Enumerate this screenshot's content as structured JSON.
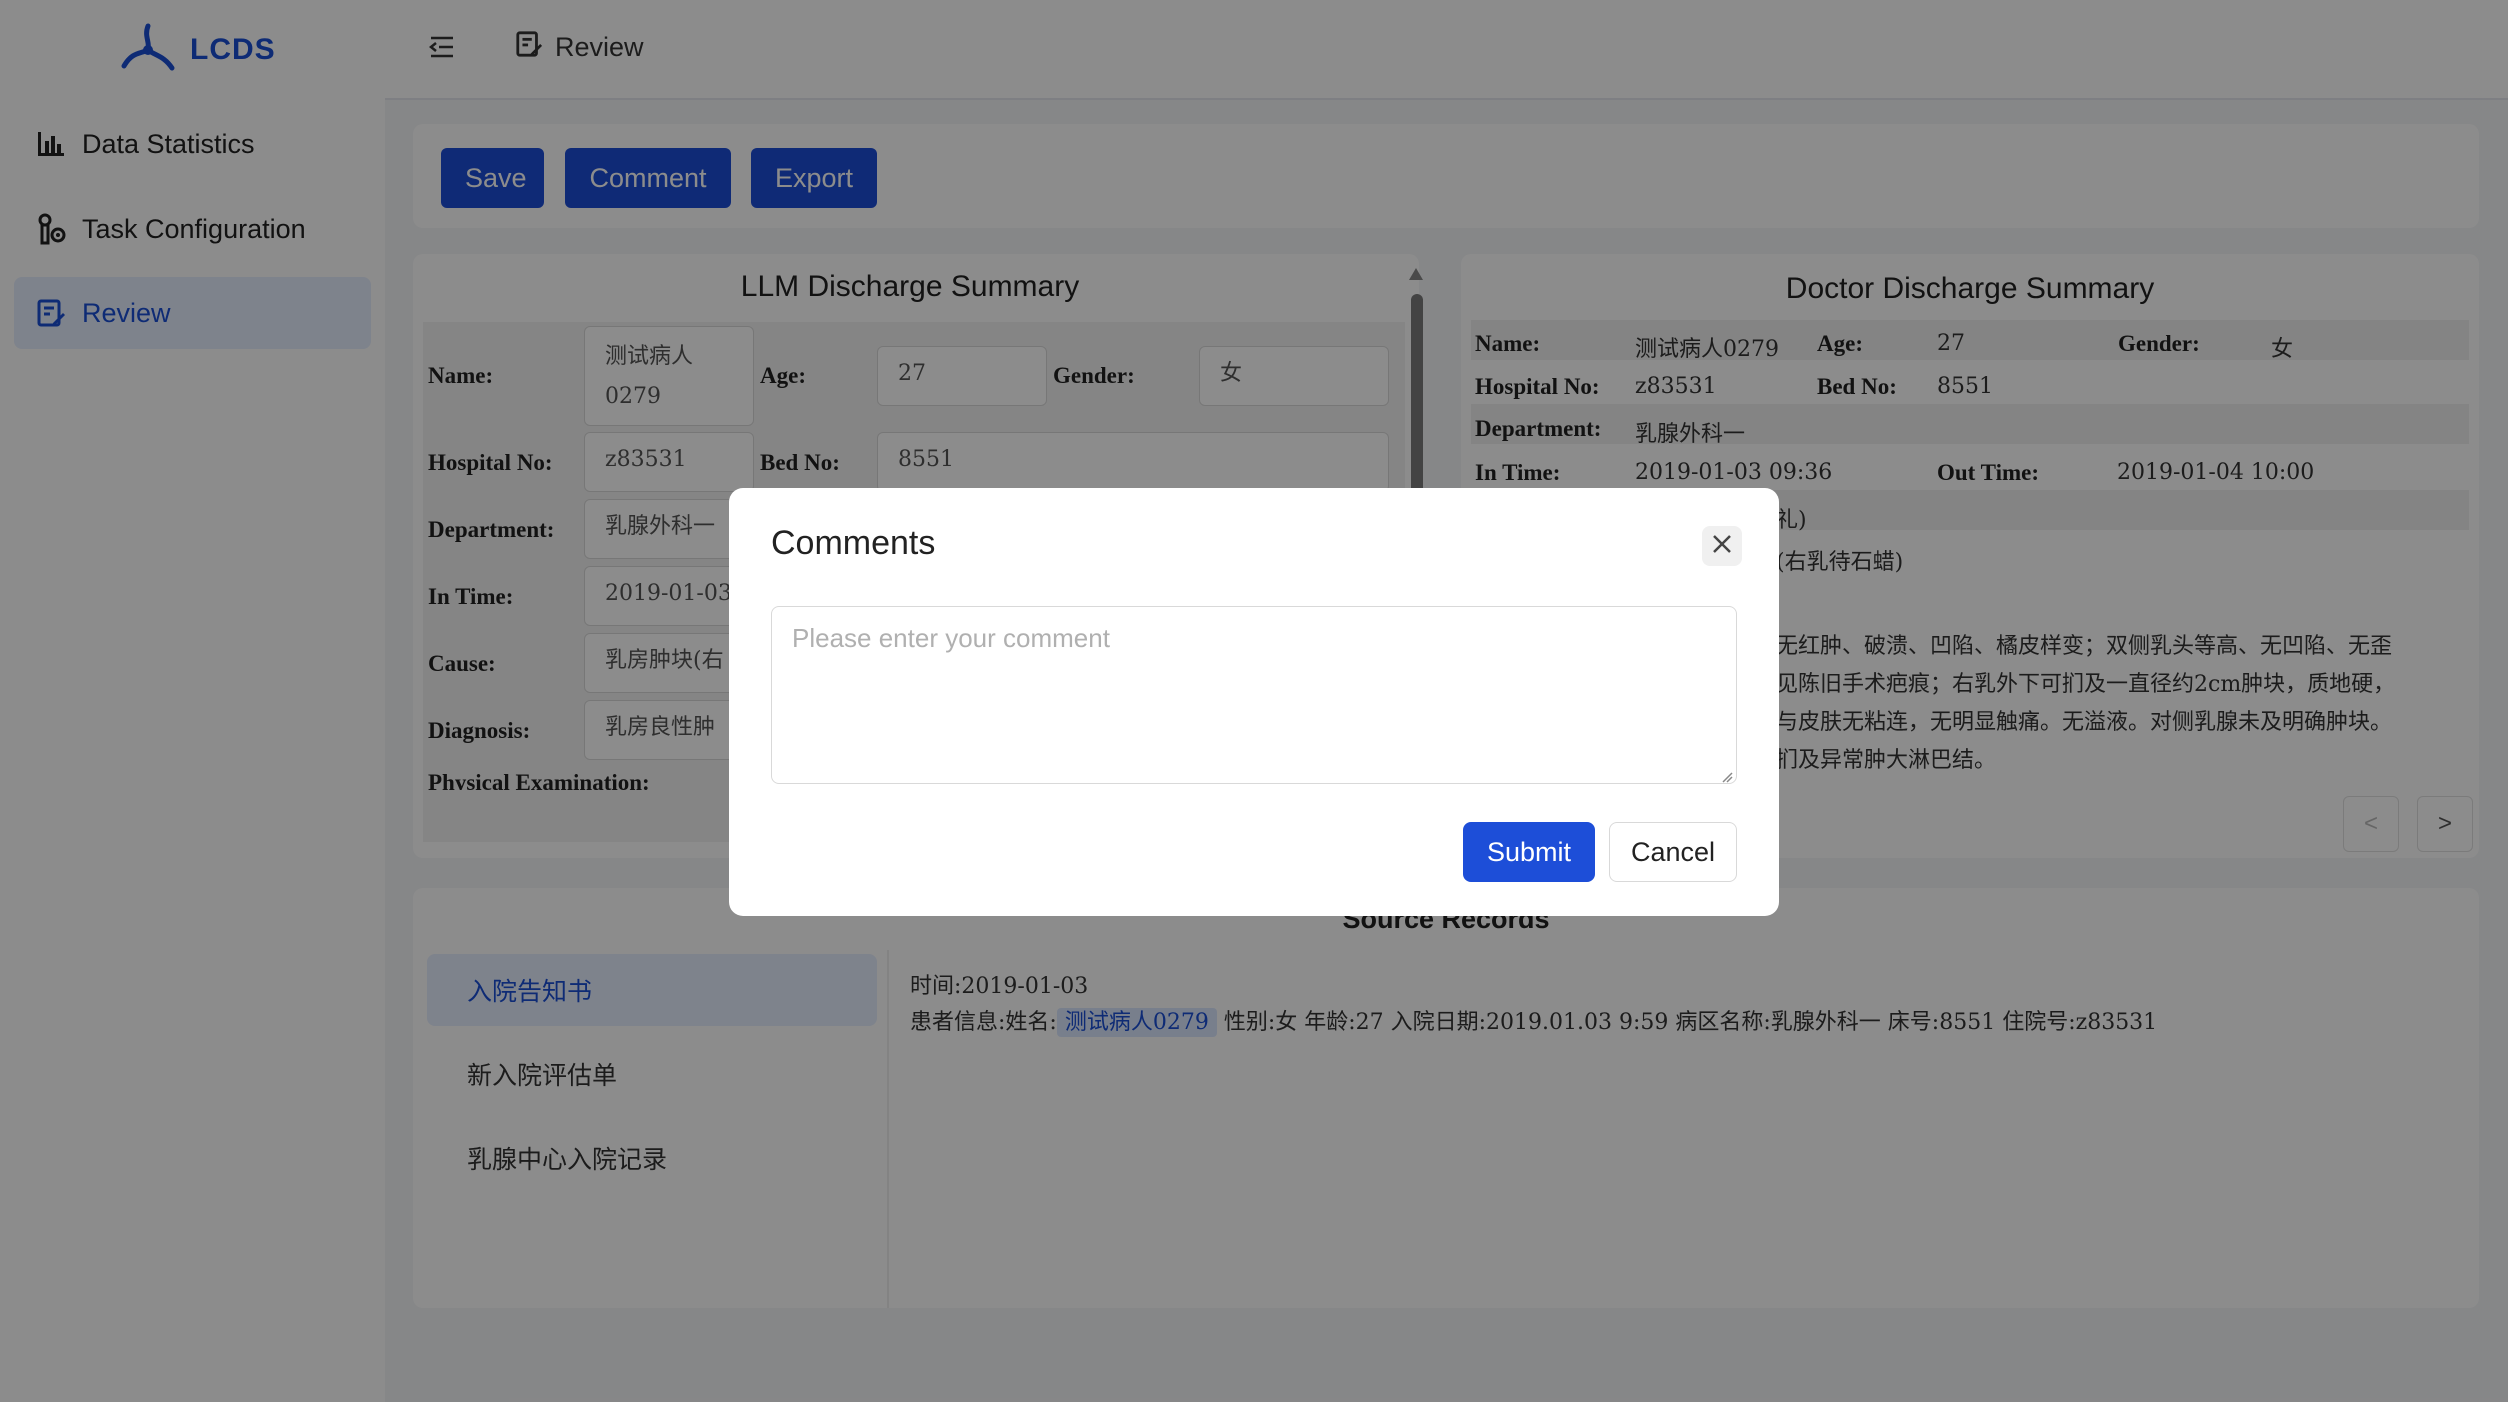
{
  "app": {
    "name": "LCDS"
  },
  "sidebar": {
    "items": [
      {
        "label": "Data Statistics",
        "icon": "bar-chart-icon"
      },
      {
        "label": "Task Configuration",
        "icon": "task-config-icon"
      },
      {
        "label": "Review",
        "icon": "edit-document-icon",
        "active": true
      }
    ]
  },
  "header": {
    "breadcrumb": "Review"
  },
  "toolbar": {
    "save_label": "Save",
    "comment_label": "Comment",
    "export_label": "Export"
  },
  "llm_summary": {
    "title": "LLM Discharge Summary",
    "name_label": "Name:",
    "name_value": "测试病人\n0279",
    "age_label": "Age:",
    "age_value": "27",
    "gender_label": "Gender:",
    "gender_value": "女",
    "hospital_no_label": "Hospital No:",
    "hospital_no_value": "z83531",
    "bed_no_label": "Bed No:",
    "bed_no_value": "8551",
    "department_label": "Department:",
    "department_value": "乳腺外科一",
    "in_time_label": "In Time:",
    "in_time_value": "2019-01-03",
    "cause_label": "Cause:",
    "cause_value": "乳房肿块(右",
    "diagnosis_label": "Diagnosis:",
    "diagnosis_value": "乳房良性肿",
    "physical_exam_label": "Physical Examination:"
  },
  "doctor_summary": {
    "title": "Doctor Discharge Summary",
    "name_label": "Name:",
    "name_value": "测试病人0279",
    "age_label": "Age:",
    "age_value": "27",
    "gender_label": "Gender:",
    "gender_value": "女",
    "hospital_no_label": "Hospital No:",
    "hospital_no_value": "z83531",
    "bed_no_label": "Bed No:",
    "bed_no_value": "8551",
    "department_label": "Department:",
    "department_value": "乳腺外科一",
    "in_time_label": "In Time:",
    "in_time_value": "2019-01-03 09:36",
    "out_time_label": "Out Time:",
    "out_time_value": "2019-01-04 10:00",
    "cause_fragment": "礼)",
    "diagnosis_fragment": "(右乳待石蜡)",
    "exam_lines": [
      "无红肿、破溃、凹陷、橘皮样变；双侧乳头等高、无凹陷、无歪",
      "见陈旧手术疤痕；右乳外下可扪及一直径约2cm肿块，质地硬，",
      "与皮肤无粘连，无明显触痛。无溢液。对侧乳腺未及明确肿块。",
      "扪及异常肿大淋巴结。"
    ],
    "prev_label": "<",
    "next_label": ">"
  },
  "source_records": {
    "title": "Source Records",
    "items": [
      {
        "label": "入院告知书",
        "active": true
      },
      {
        "label": "新入院评估单"
      },
      {
        "label": "乳腺中心入院记录"
      }
    ],
    "time_line": "时间:2019-01-03",
    "info_prefix": "患者信息:姓名:",
    "info_highlight": "测试病人0279",
    "info_rest": " 性别:女 年龄:27 入院日期:2019.01.03 9:59 病区名称:乳腺外科一 床号:8551 住院号:z83531"
  },
  "modal": {
    "title": "Comments",
    "placeholder": "Please enter your comment",
    "submit_label": "Submit",
    "cancel_label": "Cancel"
  },
  "colors": {
    "primary": "#1d4ed8",
    "active_bg": "#e6efff",
    "overlay": "rgba(0,0,0,0.45)"
  }
}
